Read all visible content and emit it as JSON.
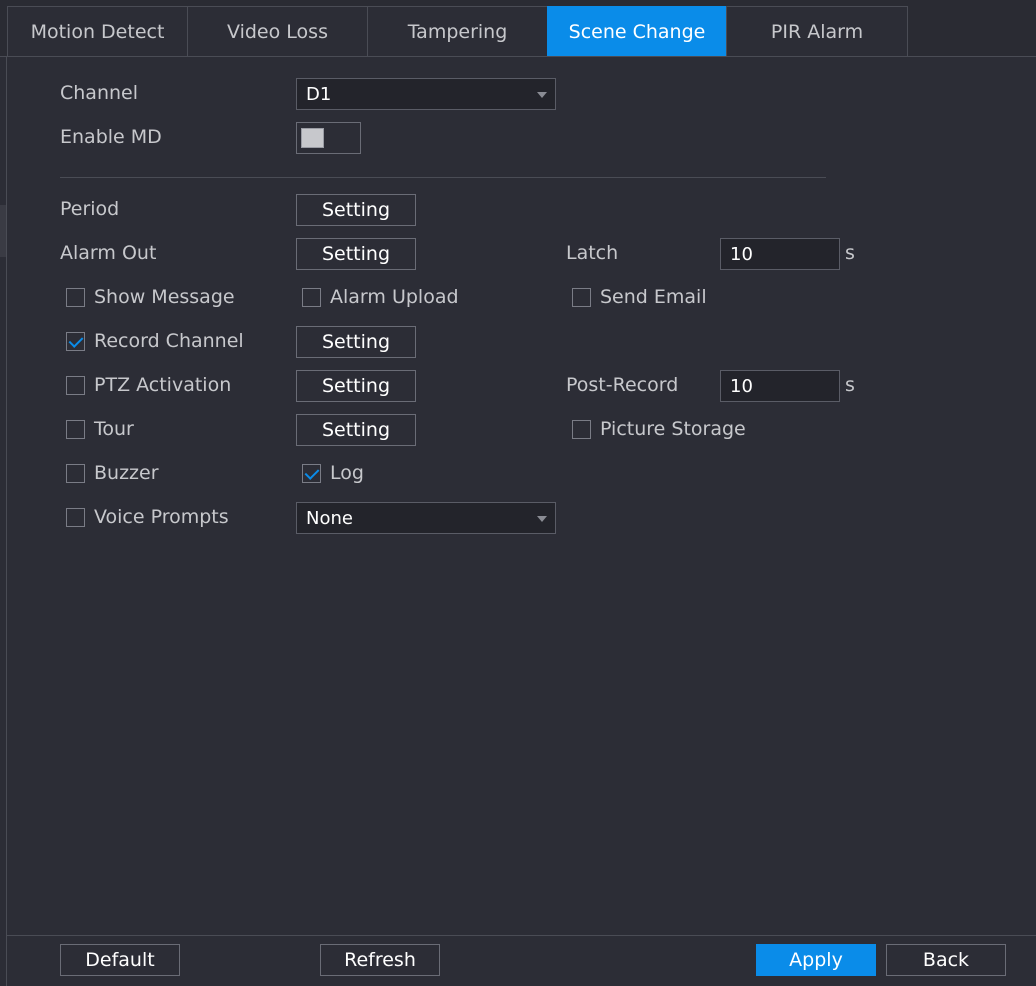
{
  "tabs": [
    {
      "label": "Motion Detect",
      "active": false
    },
    {
      "label": "Video Loss",
      "active": false
    },
    {
      "label": "Tampering",
      "active": false
    },
    {
      "label": "Scene Change",
      "active": true
    },
    {
      "label": "PIR Alarm",
      "active": false
    }
  ],
  "form": {
    "channel_label": "Channel",
    "channel_value": "D1",
    "enable_md_label": "Enable MD",
    "enable_md_on": false,
    "period_label": "Period",
    "alarm_out_label": "Alarm Out",
    "setting_label": "Setting",
    "latch_label": "Latch",
    "latch_value": "10",
    "seconds_unit": "s",
    "show_message_label": "Show Message",
    "show_message_checked": false,
    "alarm_upload_label": "Alarm Upload",
    "alarm_upload_checked": false,
    "send_email_label": "Send Email",
    "send_email_checked": false,
    "record_channel_label": "Record Channel",
    "record_channel_checked": true,
    "ptz_activation_label": "PTZ Activation",
    "ptz_activation_checked": false,
    "post_record_label": "Post-Record",
    "post_record_value": "10",
    "tour_label": "Tour",
    "tour_checked": false,
    "picture_storage_label": "Picture Storage",
    "picture_storage_checked": false,
    "buzzer_label": "Buzzer",
    "buzzer_checked": false,
    "log_label": "Log",
    "log_checked": true,
    "voice_prompts_label": "Voice Prompts",
    "voice_prompts_checked": false,
    "voice_prompts_value": "None"
  },
  "footer": {
    "default_label": "Default",
    "refresh_label": "Refresh",
    "apply_label": "Apply",
    "back_label": "Back"
  },
  "colors": {
    "accent": "#0a8ce9",
    "background": "#2c2d36"
  }
}
